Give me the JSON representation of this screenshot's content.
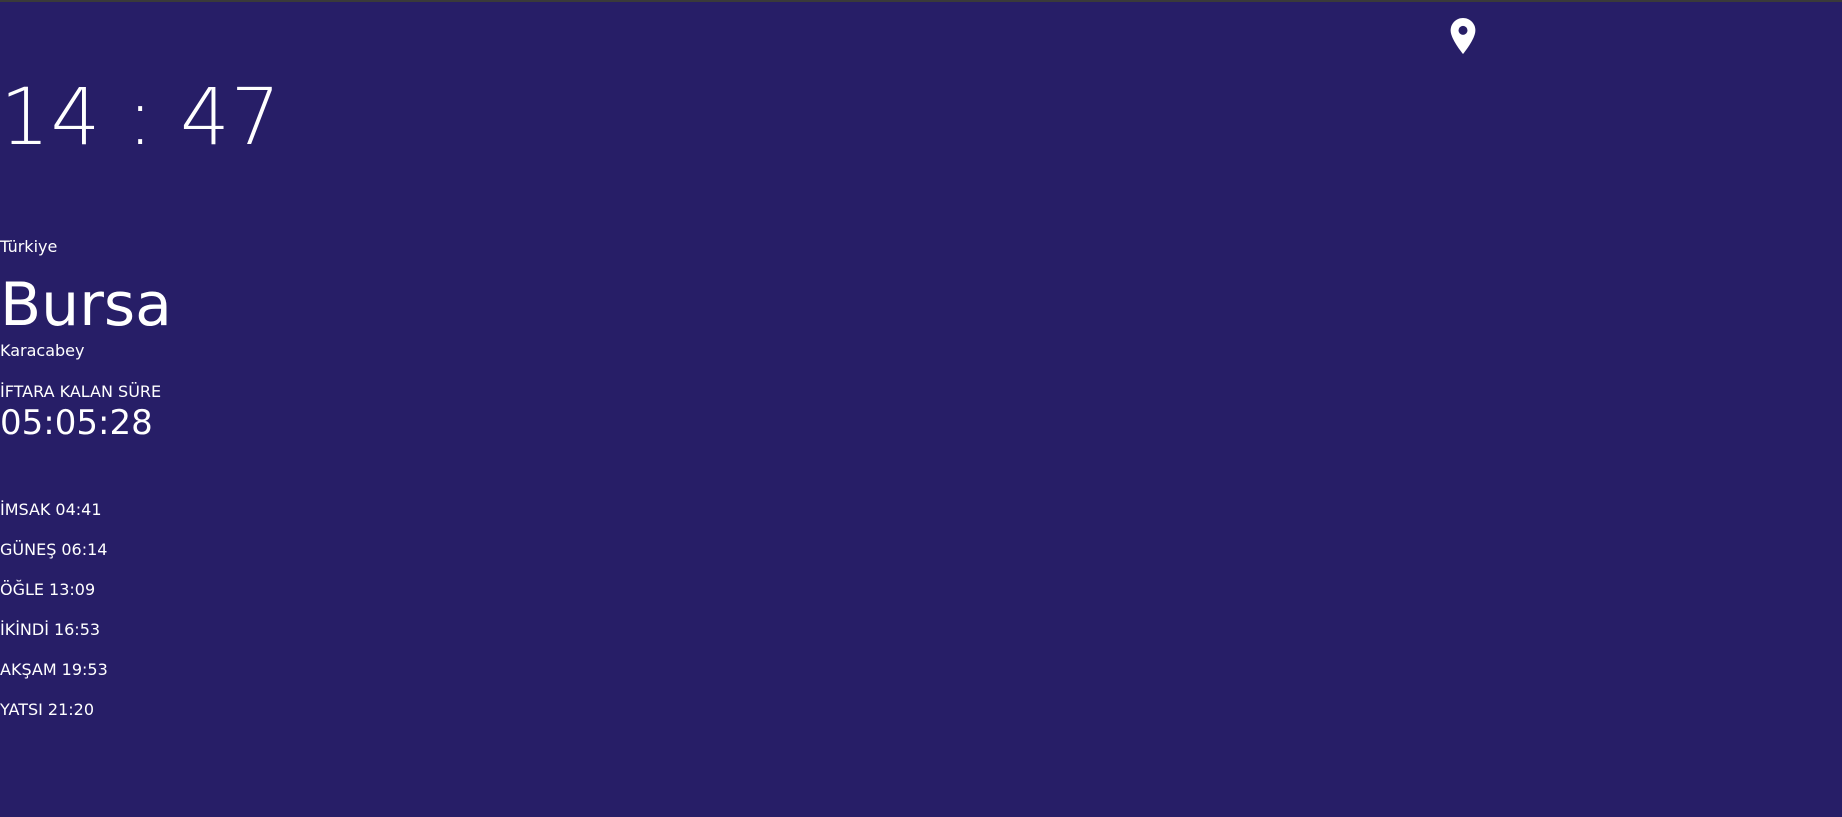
{
  "clock": {
    "display": "14 : 47"
  },
  "location": {
    "country": "Türkiye",
    "city": "Bursa",
    "district": "Karacabey",
    "icon": "map-pin-icon"
  },
  "countdown": {
    "label": "İFTARA KALAN SÜRE",
    "value": "05:05:28"
  },
  "prayer_times": [
    {
      "name": "İMSAK",
      "time": "04:41"
    },
    {
      "name": "GÜNEŞ",
      "time": "06:14"
    },
    {
      "name": "ÖĞLE",
      "time": "13:09"
    },
    {
      "name": "İKİNDİ",
      "time": "16:53"
    },
    {
      "name": "AKŞAM",
      "time": "19:53"
    },
    {
      "name": "YATSI",
      "time": "21:20"
    }
  ],
  "colors": {
    "background": "#271e67",
    "text": "#ffffff"
  }
}
